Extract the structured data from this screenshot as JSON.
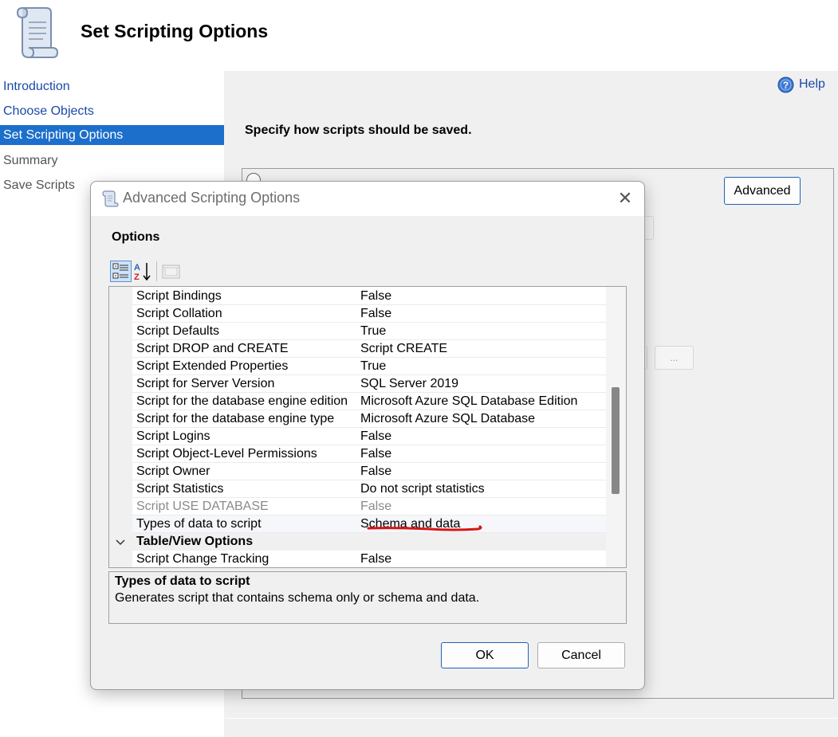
{
  "header": {
    "title": "Set Scripting Options"
  },
  "nav": {
    "items": [
      {
        "label": "Introduction",
        "state": "link"
      },
      {
        "label": "Choose Objects",
        "state": "link"
      },
      {
        "label": "Set Scripting Options",
        "state": "active"
      },
      {
        "label": "Summary",
        "state": "disabled"
      },
      {
        "label": "Save Scripts",
        "state": "disabled"
      }
    ]
  },
  "content": {
    "help_label": "Help",
    "instruction": "Specify how scripts should be saved.",
    "advanced_label": "Advanced",
    "ellipsis_label": "..."
  },
  "dialog": {
    "title": "Advanced Scripting Options",
    "close_glyph": "✕",
    "options_label": "Options",
    "rows": [
      {
        "name": "Script Bindings",
        "value": "False"
      },
      {
        "name": "Script Collation",
        "value": "False"
      },
      {
        "name": "Script Defaults",
        "value": "True"
      },
      {
        "name": "Script DROP and CREATE",
        "value": "Script CREATE"
      },
      {
        "name": "Script Extended Properties",
        "value": "True"
      },
      {
        "name": "Script for Server Version",
        "value": "SQL Server 2019"
      },
      {
        "name": "Script for the database engine edition",
        "value": "Microsoft Azure SQL Database Edition"
      },
      {
        "name": "Script for the database engine type",
        "value": "Microsoft Azure SQL Database"
      },
      {
        "name": "Script Logins",
        "value": "False"
      },
      {
        "name": "Script Object-Level Permissions",
        "value": "False"
      },
      {
        "name": "Script Owner",
        "value": "False"
      },
      {
        "name": "Script Statistics",
        "value": "Do not script statistics"
      },
      {
        "name": "Script USE DATABASE",
        "value": "False",
        "disabled": true
      },
      {
        "name": "Types of data to script",
        "value": "Schema and data",
        "selected": true
      },
      {
        "name": "Table/View Options",
        "value": "",
        "category": true
      },
      {
        "name": "Script Change Tracking",
        "value": "False"
      }
    ],
    "description": {
      "title": "Types of data to script",
      "text": "Generates script that contains schema only or schema and data."
    },
    "ok_label": "OK",
    "cancel_label": "Cancel"
  },
  "colors": {
    "nav_active_bg": "#1c6fcb",
    "link_text": "#1a4aa8",
    "annotation_red": "#d81414",
    "scroll_thumb": "#878787"
  },
  "icons": [
    "script-scroll-icon",
    "help-icon",
    "categorized-icon",
    "alphabetical-sort-icon",
    "property-pages-icon",
    "chevron-down-icon",
    "close-icon"
  ]
}
